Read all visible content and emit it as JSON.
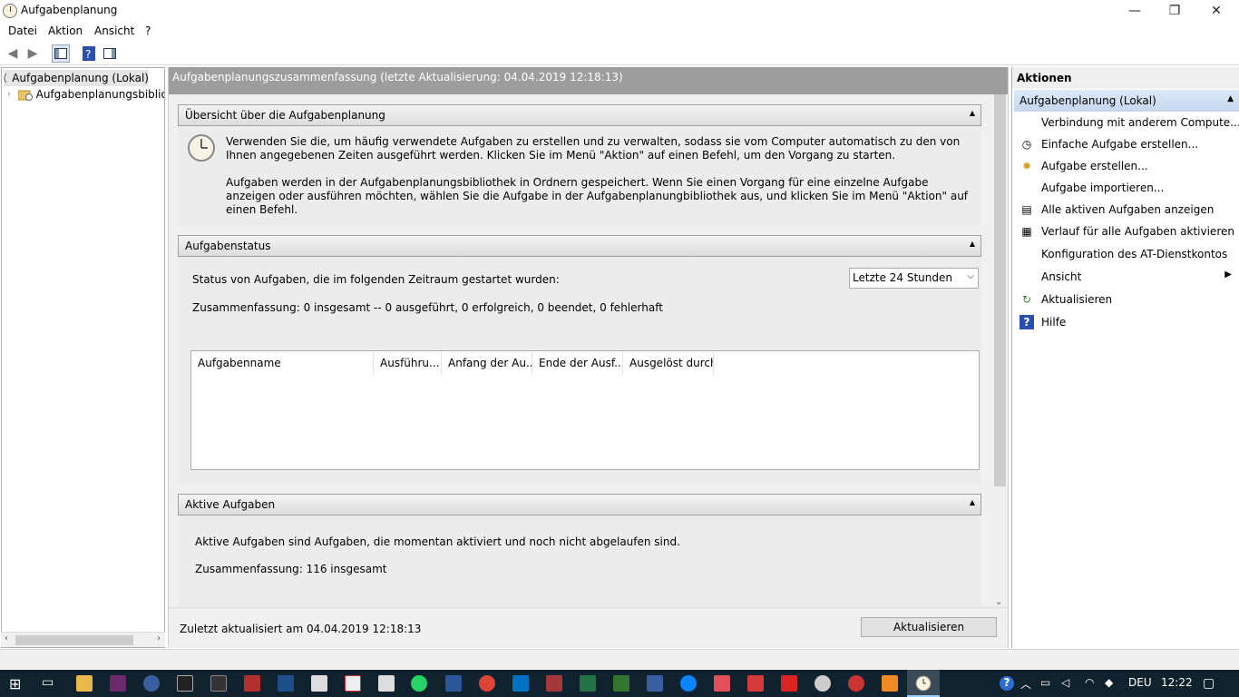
{
  "window": {
    "title": "Aufgabenplanung",
    "minimize": "—",
    "restore": "❐",
    "close": "✕"
  },
  "menu": [
    "Datei",
    "Aktion",
    "Ansicht",
    "?"
  ],
  "tree": {
    "root": "Aufgabenplanung (Lokal)",
    "child": "Aufgabenplanungsbibliothek"
  },
  "center": {
    "header": "Aufgabenplanungszusammenfassung (letzte Aktualisierung: 04.04.2019 12:18:13)",
    "overview": {
      "title": "Übersicht über die Aufgabenplanung",
      "p1": "Verwenden Sie die, um häufig verwendete Aufgaben zu erstellen und zu verwalten, sodass sie vom Computer automatisch zu den von Ihnen angegebenen Zeiten ausgeführt werden. Klicken Sie im Menü \"Aktion\" auf einen Befehl, um den Vorgang zu starten.",
      "p2": "Aufgaben werden in der Aufgabenplanungsbibliothek in Ordnern gespeichert. Wenn Sie einen Vorgang für eine einzelne Aufgabe anzeigen oder ausführen möchten, wählen Sie die Aufgabe in der Aufgabenplanungbibliothek aus, und klicken Sie im Menü \"Aktion\" auf einen Befehl."
    },
    "status": {
      "title": "Aufgabenstatus",
      "label": "Status von Aufgaben, die im folgenden Zeitraum gestartet wurden:",
      "range": "Letzte 24 Stunden",
      "summary": "Zusammenfassung: 0 insgesamt -- 0 ausgeführt, 0 erfolgreich, 0 beendet, 0 fehlerhaft",
      "columns": [
        "Aufgabenname",
        "Ausführu...",
        "Anfang der Au...",
        "Ende der Ausf...",
        "Ausgelöst durch"
      ]
    },
    "active": {
      "title": "Aktive Aufgaben",
      "desc": "Aktive Aufgaben sind Aufgaben, die momentan aktiviert und noch nicht abgelaufen sind.",
      "summary": "Zusammenfassung: 116 insgesamt"
    },
    "footer": {
      "updated": "Zuletzt aktualisiert am 04.04.2019 12:18:13",
      "refresh": "Aktualisieren"
    }
  },
  "actions": {
    "title": "Aktionen",
    "section": "Aufgabenplanung (Lokal)",
    "items": [
      "Verbindung mit anderem Compute...",
      "Einfache Aufgabe erstellen...",
      "Aufgabe erstellen...",
      "Aufgabe importieren...",
      "Alle aktiven Aufgaben anzeigen",
      "Verlauf für alle Aufgaben aktivieren",
      "Konfiguration des AT-Dienstkontos",
      "Ansicht",
      "Aktualisieren",
      "Hilfe"
    ]
  },
  "taskbar": {
    "lang": "DEU",
    "time": "12:22"
  }
}
